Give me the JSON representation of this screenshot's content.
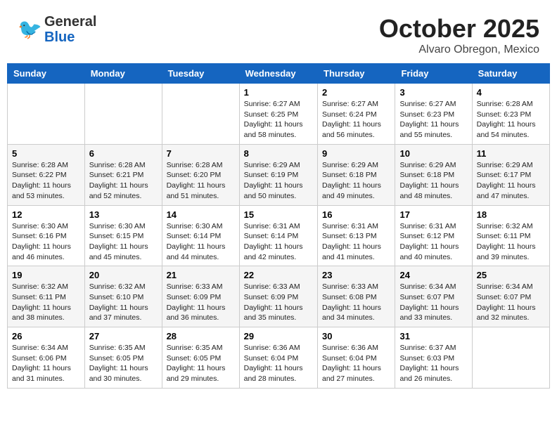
{
  "header": {
    "logo_line1": "General",
    "logo_line2": "Blue",
    "month": "October 2025",
    "location": "Alvaro Obregon, Mexico"
  },
  "weekdays": [
    "Sunday",
    "Monday",
    "Tuesday",
    "Wednesday",
    "Thursday",
    "Friday",
    "Saturday"
  ],
  "weeks": [
    [
      {
        "day": "",
        "info": ""
      },
      {
        "day": "",
        "info": ""
      },
      {
        "day": "",
        "info": ""
      },
      {
        "day": "1",
        "info": "Sunrise: 6:27 AM\nSunset: 6:25 PM\nDaylight: 11 hours\nand 58 minutes."
      },
      {
        "day": "2",
        "info": "Sunrise: 6:27 AM\nSunset: 6:24 PM\nDaylight: 11 hours\nand 56 minutes."
      },
      {
        "day": "3",
        "info": "Sunrise: 6:27 AM\nSunset: 6:23 PM\nDaylight: 11 hours\nand 55 minutes."
      },
      {
        "day": "4",
        "info": "Sunrise: 6:28 AM\nSunset: 6:23 PM\nDaylight: 11 hours\nand 54 minutes."
      }
    ],
    [
      {
        "day": "5",
        "info": "Sunrise: 6:28 AM\nSunset: 6:22 PM\nDaylight: 11 hours\nand 53 minutes."
      },
      {
        "day": "6",
        "info": "Sunrise: 6:28 AM\nSunset: 6:21 PM\nDaylight: 11 hours\nand 52 minutes."
      },
      {
        "day": "7",
        "info": "Sunrise: 6:28 AM\nSunset: 6:20 PM\nDaylight: 11 hours\nand 51 minutes."
      },
      {
        "day": "8",
        "info": "Sunrise: 6:29 AM\nSunset: 6:19 PM\nDaylight: 11 hours\nand 50 minutes."
      },
      {
        "day": "9",
        "info": "Sunrise: 6:29 AM\nSunset: 6:18 PM\nDaylight: 11 hours\nand 49 minutes."
      },
      {
        "day": "10",
        "info": "Sunrise: 6:29 AM\nSunset: 6:18 PM\nDaylight: 11 hours\nand 48 minutes."
      },
      {
        "day": "11",
        "info": "Sunrise: 6:29 AM\nSunset: 6:17 PM\nDaylight: 11 hours\nand 47 minutes."
      }
    ],
    [
      {
        "day": "12",
        "info": "Sunrise: 6:30 AM\nSunset: 6:16 PM\nDaylight: 11 hours\nand 46 minutes."
      },
      {
        "day": "13",
        "info": "Sunrise: 6:30 AM\nSunset: 6:15 PM\nDaylight: 11 hours\nand 45 minutes."
      },
      {
        "day": "14",
        "info": "Sunrise: 6:30 AM\nSunset: 6:14 PM\nDaylight: 11 hours\nand 44 minutes."
      },
      {
        "day": "15",
        "info": "Sunrise: 6:31 AM\nSunset: 6:14 PM\nDaylight: 11 hours\nand 42 minutes."
      },
      {
        "day": "16",
        "info": "Sunrise: 6:31 AM\nSunset: 6:13 PM\nDaylight: 11 hours\nand 41 minutes."
      },
      {
        "day": "17",
        "info": "Sunrise: 6:31 AM\nSunset: 6:12 PM\nDaylight: 11 hours\nand 40 minutes."
      },
      {
        "day": "18",
        "info": "Sunrise: 6:32 AM\nSunset: 6:11 PM\nDaylight: 11 hours\nand 39 minutes."
      }
    ],
    [
      {
        "day": "19",
        "info": "Sunrise: 6:32 AM\nSunset: 6:11 PM\nDaylight: 11 hours\nand 38 minutes."
      },
      {
        "day": "20",
        "info": "Sunrise: 6:32 AM\nSunset: 6:10 PM\nDaylight: 11 hours\nand 37 minutes."
      },
      {
        "day": "21",
        "info": "Sunrise: 6:33 AM\nSunset: 6:09 PM\nDaylight: 11 hours\nand 36 minutes."
      },
      {
        "day": "22",
        "info": "Sunrise: 6:33 AM\nSunset: 6:09 PM\nDaylight: 11 hours\nand 35 minutes."
      },
      {
        "day": "23",
        "info": "Sunrise: 6:33 AM\nSunset: 6:08 PM\nDaylight: 11 hours\nand 34 minutes."
      },
      {
        "day": "24",
        "info": "Sunrise: 6:34 AM\nSunset: 6:07 PM\nDaylight: 11 hours\nand 33 minutes."
      },
      {
        "day": "25",
        "info": "Sunrise: 6:34 AM\nSunset: 6:07 PM\nDaylight: 11 hours\nand 32 minutes."
      }
    ],
    [
      {
        "day": "26",
        "info": "Sunrise: 6:34 AM\nSunset: 6:06 PM\nDaylight: 11 hours\nand 31 minutes."
      },
      {
        "day": "27",
        "info": "Sunrise: 6:35 AM\nSunset: 6:05 PM\nDaylight: 11 hours\nand 30 minutes."
      },
      {
        "day": "28",
        "info": "Sunrise: 6:35 AM\nSunset: 6:05 PM\nDaylight: 11 hours\nand 29 minutes."
      },
      {
        "day": "29",
        "info": "Sunrise: 6:36 AM\nSunset: 6:04 PM\nDaylight: 11 hours\nand 28 minutes."
      },
      {
        "day": "30",
        "info": "Sunrise: 6:36 AM\nSunset: 6:04 PM\nDaylight: 11 hours\nand 27 minutes."
      },
      {
        "day": "31",
        "info": "Sunrise: 6:37 AM\nSunset: 6:03 PM\nDaylight: 11 hours\nand 26 minutes."
      },
      {
        "day": "",
        "info": ""
      }
    ]
  ]
}
